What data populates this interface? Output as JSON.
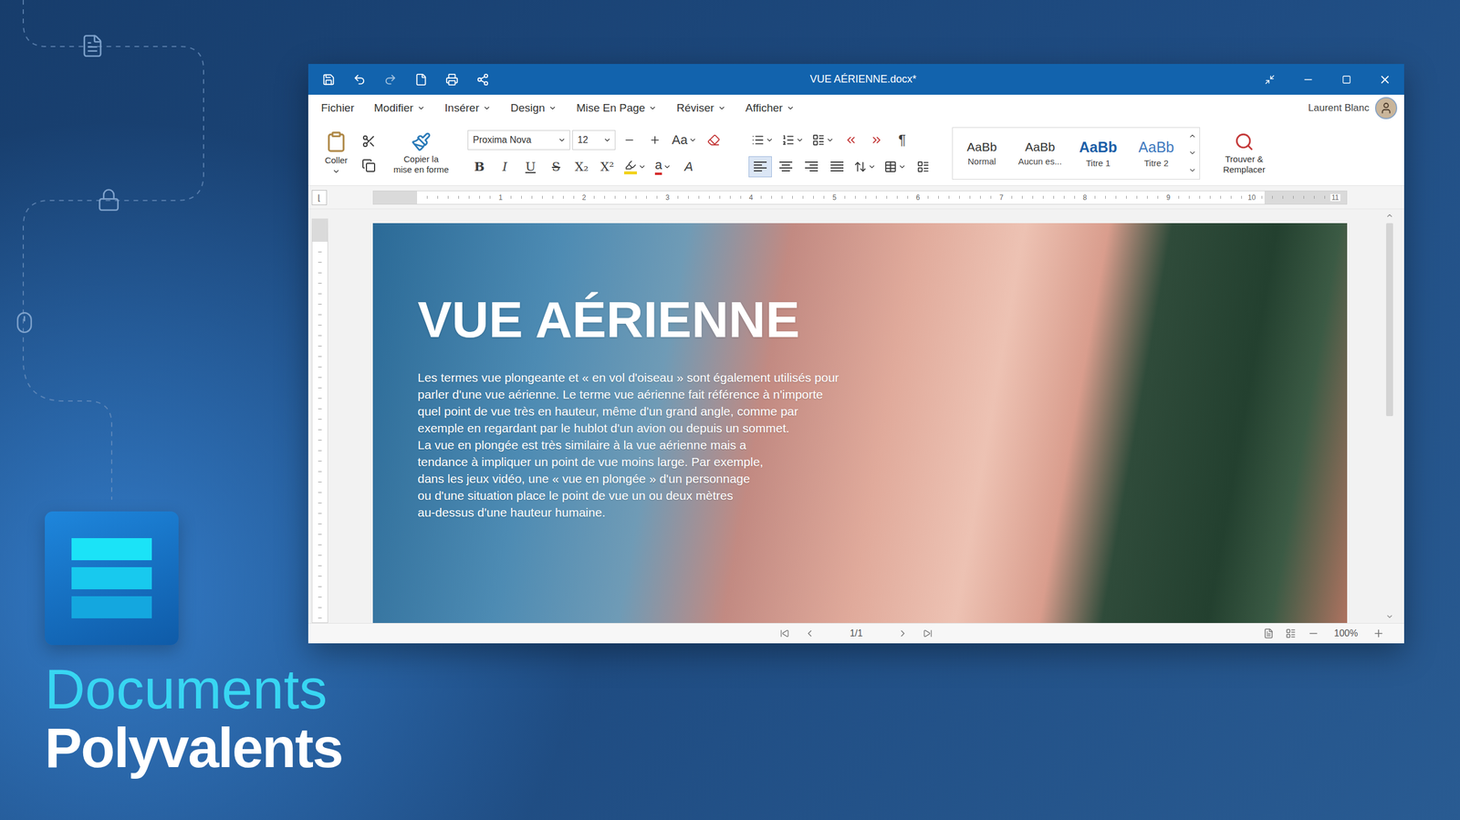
{
  "promo": {
    "heading": "Documents",
    "subheading": "Polyvalents"
  },
  "window": {
    "title": "VUE AÉRIENNE.docx*"
  },
  "menu": [
    {
      "label": "Fichier",
      "dropdown": false
    },
    {
      "label": "Modifier",
      "dropdown": true
    },
    {
      "label": "Insérer",
      "dropdown": true
    },
    {
      "label": "Design",
      "dropdown": true
    },
    {
      "label": "Mise En Page",
      "dropdown": true
    },
    {
      "label": "Réviser",
      "dropdown": true
    },
    {
      "label": "Afficher",
      "dropdown": true
    }
  ],
  "user": {
    "name": "Laurent Blanc"
  },
  "ribbon": {
    "paste": "Coller",
    "format_painter": "Copier la\nmise en forme",
    "font_family": "Proxima Nova",
    "font_size": "12",
    "case_button": "Aa",
    "text_styles": [
      {
        "label": "B",
        "kind": "bold",
        "selected": false
      },
      {
        "label": "I",
        "kind": "italic",
        "selected": false
      },
      {
        "label": "U",
        "kind": "underline",
        "selected": false
      },
      {
        "label": "S",
        "kind": "strike",
        "selected": false
      },
      {
        "label": "X₂",
        "kind": "plain",
        "selected": false
      },
      {
        "label": "X²",
        "kind": "plain",
        "selected": false
      }
    ],
    "highlight_color": "#f2d21b",
    "font_color": {
      "label": "a",
      "color": "#d42a2a"
    },
    "text_effects": "A",
    "pilcrow": "¶",
    "alignments": [
      {
        "kind": "left",
        "selected": true
      },
      {
        "kind": "center",
        "selected": false
      },
      {
        "kind": "right",
        "selected": false
      },
      {
        "kind": "justify",
        "selected": false
      }
    ],
    "styles": [
      {
        "preview": "AaBb",
        "label": "Normal",
        "kind": "plain"
      },
      {
        "preview": "AaBb",
        "label": "Aucun es...",
        "kind": "plain"
      },
      {
        "preview": "AaBb",
        "label": "Titre 1",
        "kind": "heading"
      },
      {
        "preview": "AaBb",
        "label": "Titre 2",
        "kind": "subheading"
      }
    ],
    "find_replace": "Trouver &\nRemplacer"
  },
  "ruler": [
    "1",
    "2",
    "3",
    "4",
    "5",
    "6",
    "7",
    "8",
    "9",
    "10",
    "11"
  ],
  "document": {
    "title": "VUE AÉRIENNE",
    "paragraph": [
      "Les termes vue plongeante et « en vol d'oiseau » sont également utilisés pour",
      "parler d'une vue aérienne. Le terme vue aérienne fait référence à n'importe",
      "quel point de vue très en hauteur, même d'un grand angle, comme par",
      "exemple en regardant par le hublot d'un avion ou depuis un sommet.",
      "La vue en plongée est très similaire à la vue aérienne mais a",
      "tendance à impliquer un point de vue moins large. Par exemple,",
      "dans les jeux vidéo, une « vue en plongée » d'un personnage",
      "ou d'une situation place le point de vue un ou deux mètres",
      "au-dessus d'une hauteur humaine."
    ]
  },
  "scrollbar": {
    "level": 0.5
  },
  "status_bar": {
    "page": "1/1",
    "zoom": "100%"
  }
}
